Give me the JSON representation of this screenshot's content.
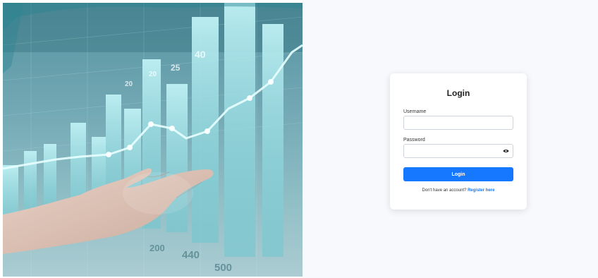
{
  "login": {
    "title": "Login",
    "username_label": "Username",
    "username_value": "",
    "password_label": "Password",
    "password_value": "",
    "submit_label": "Login",
    "register_prompt": "Don't have an account?",
    "register_link": "Register here"
  },
  "hero_figures": {
    "label_a": "20",
    "label_b": "40",
    "label_c": "25",
    "label_d": "20",
    "label_e": "200",
    "label_f": "440",
    "label_g": "500"
  },
  "colors": {
    "accent": "#1677ff",
    "page_background": "#f7f9fc",
    "card_background": "#ffffff"
  }
}
